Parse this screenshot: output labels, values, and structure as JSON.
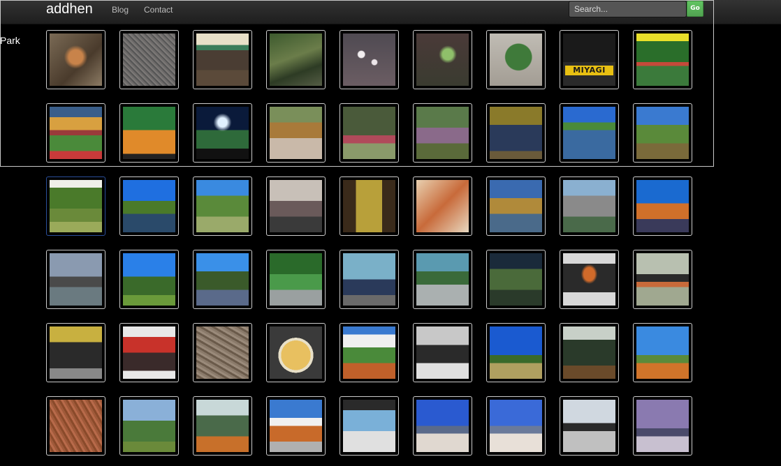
{
  "navbar": {
    "brand": "addhen",
    "links": [
      "Blog",
      "Contact"
    ],
    "search_placeholder": "Search...",
    "search_button": "Go"
  },
  "side_label": "Park",
  "overlay_text": "MIYAGI",
  "colors": {
    "navbar": "#2c2c2c",
    "go_button": "#5bb75b",
    "thumb_border": "#cccccc",
    "active_border": "#2a4f9a"
  },
  "gallery": [
    [
      {
        "name": "dry-leaves-cat-photo",
        "bg": "radial-gradient(circle at 50% 45%, #c8834a 0 18%, transparent 30%), linear-gradient(135deg,#7a6a55,#4a3b2c 60%,#8c7b64)"
      },
      {
        "name": "gravel-ground-photo",
        "bg": "repeating-linear-gradient(45deg,#6e6b6a 0 2px,#555 2px 4px,#7d7a78 4px 6px)"
      },
      {
        "name": "garden-shelter-photo",
        "bg": "linear-gradient(#e8e0c8 0 22%,#3b7d5a 22% 32%,#4a3d33 32% 70%,#5b4a3a 70%)"
      },
      {
        "name": "forest-stream-photo",
        "bg": "linear-gradient(160deg,#3d5a2e,#6b7d4a 45%,#2d3b24 70%,#555d45)"
      },
      {
        "name": "white-flowers-photo",
        "bg": "radial-gradient(circle at 35% 40%,#f2eef0 0 7%,transparent 9%), radial-gradient(circle at 60% 55%,#ede6ea 0 6%,transparent 8%), linear-gradient(#4f4a52,#6b5d63)"
      },
      {
        "name": "green-plant-photo",
        "bg": "radial-gradient(circle at 60% 40%,#8fbf6a 0 12%,transparent 20%), linear-gradient(#4a3a38,#3a3b30)"
      },
      {
        "name": "round-shrub-photo",
        "bg": "radial-gradient(circle at 55% 45%,#3f7a3a 0 32%,transparent 34%), linear-gradient(#c0bcb4,#a39d94)"
      },
      {
        "name": "miyagi-stadium-sign-photo",
        "bg": "linear-gradient(#1a1a1a 0 55%,#2a2a2a 55%)",
        "overlay": true
      },
      {
        "name": "stadium-crowd-photo",
        "bg": "linear-gradient(#e9e02a 0 15%,#2a6e2a 15% 55%,#c54a3a 55% 62%,#3b7a3b 62%)"
      }
    ],
    [
      {
        "name": "packed-stadium-photo",
        "bg": "linear-gradient(#3a5e8a 0 20%,#d8a040 20% 45%,#9a3a3a 45% 55%,#4a8a3a 55% 85%,#c83a3a 85%)"
      },
      {
        "name": "stadium-fan-photo",
        "bg": "linear-gradient(#2a7a3a 0 45%,#e08a2a 45% 90%,#222 90%)"
      },
      {
        "name": "stadium-night-lights-photo",
        "bg": "radial-gradient(circle at 50% 30%,#e0f0ff 0 10%,transparent 20%), linear-gradient(#0a1a3a 0 45%,#2e6a3a 45% 80%,#111 80%)"
      },
      {
        "name": "autumn-path-photo",
        "bg": "linear-gradient(#7a8f5a 0 30%,#a87a3a 30% 60%,#c9b9a9 60%)"
      },
      {
        "name": "autumn-garden-photo",
        "bg": "linear-gradient(#4a5a3a 0 55%,#b04a5a 55% 70%,#8a9a6a 70%)"
      },
      {
        "name": "woodland-trail-photo",
        "bg": "linear-gradient(#5a7a4a 0 40%,#8a6a8a 40% 70%,#5a6a3a 70%)"
      },
      {
        "name": "leafy-path-photo",
        "bg": "linear-gradient(#8a7a2a 0 35%,#2a3a5a 35% 85%,#6a5a3a 85%)"
      },
      {
        "name": "pond-reflection-photo",
        "bg": "linear-gradient(#2a6ad0 0 30%,#4a8a3a 30% 45%,#3a6aa0 45%)"
      },
      {
        "name": "park-hills-photo",
        "bg": "linear-gradient(#3a7ad0 0 35%,#5a8a3a 35% 70%,#7a6a3a 70%)"
      }
    ],
    [
      {
        "name": "garden-trees-photo",
        "active": true,
        "bg": "linear-gradient(#f0f0e8 0 15%,#4a7a2a 15% 55%,#6a8a3a 55% 80%,#9aaa5a 80%)"
      },
      {
        "name": "autumn-lake-photo",
        "bg": "linear-gradient(#1f6fe0 0 40%,#4a7a2a 40% 65%,#2a4a6a 65%)"
      },
      {
        "name": "valley-garden-photo",
        "bg": "linear-gradient(#3a8ae0 0 30%,#5a8a3a 30% 70%,#9aaa6a 70%)"
      },
      {
        "name": "city-street-crowd-photo",
        "bg": "linear-gradient(#c8c0b8 0 40%,#6a5a5a 40% 70%,#3a3a3a 70%)"
      },
      {
        "name": "menu-poster-photo",
        "bg": "linear-gradient(90deg,#3a2a1a 0 25%,#b8a03a 25% 75%,#3a2a1a 75%)"
      },
      {
        "name": "food-menu-photo",
        "bg": "linear-gradient(135deg,#e8d0b0,#c86a3a 50%,#e8d8c0)"
      },
      {
        "name": "autumn-park-photo",
        "bg": "linear-gradient(#3a6ab0 0 35%,#b08a3a 35% 65%,#4a6a8a 65%)"
      },
      {
        "name": "city-aerial-photo",
        "bg": "linear-gradient(#8ab0d0 0 30%,#8a8a8a 30% 70%,#4a6a4a 70%)"
      },
      {
        "name": "city-towers-photo",
        "bg": "linear-gradient(#1a6ad0 0 45%,#d0702a 45% 75%,#3a3a5a 75%)"
      }
    ],
    [
      {
        "name": "city-waterfront-photo",
        "bg": "linear-gradient(#8a9ab0 0 45%,#4a4a4a 45% 65%,#6a7a80 65%)"
      },
      {
        "name": "clear-sky-forest-photo",
        "bg": "linear-gradient(#2a80e8 0 45%,#3a6a2a 45% 80%,#6a9a3a 80%)"
      },
      {
        "name": "river-trees-photo",
        "bg": "linear-gradient(#3a90e8 0 35%,#3a5a2a 35% 70%,#5a6a8a 70%)"
      },
      {
        "name": "mossy-waterfall-photo",
        "bg": "linear-gradient(#2a6a2a 0 40%,#4a9a4a 40% 70%,#9aa0a0 70%)"
      },
      {
        "name": "station-building-photo",
        "bg": "linear-gradient(#7ab0c8 0 50%,#2a3a5a 50% 80%,#6a6a6a 80%)"
      },
      {
        "name": "canal-view-photo",
        "bg": "linear-gradient(#5a9ab0 0 35%,#3a6a3a 35% 60%,#aab0b0 60%)"
      },
      {
        "name": "bookshelf-room-photo",
        "bg": "linear-gradient(#1a2a3a 0 30%,#4a6a3a 30% 70%,#2a3a2a 70%)"
      },
      {
        "name": "laptop-desk-photo",
        "bg": "radial-gradient(ellipse at 50% 40%,#d06a2a 0 15%,transparent 22%), linear-gradient(#d8d8d8 0 20%,#2a2a2a 20% 75%,#d8d8d8 75%)"
      },
      {
        "name": "colorful-bags-photo",
        "bg": "linear-gradient(#b8c0b0 0 40%,#2a2a2a 40% 55%,#c86a3a 55% 65%,#a0a890 65%)"
      }
    ],
    [
      {
        "name": "vintage-car-photo",
        "bg": "linear-gradient(#c8b040 0 30%,#2a2a2a 30% 80%,#888 80%)"
      },
      {
        "name": "carved-stool-photo",
        "bg": "linear-gradient(#e8e8e8 0 20%,#c8322a 20% 50%,#3a2a2a 50% 85%,#e8e8e8 85%)"
      },
      {
        "name": "pebble-ground-photo",
        "bg": "repeating-linear-gradient(30deg,#8a7a6a 0 3px,#6a5a4a 3px 6px,#9a8a7a 6px 9px)"
      },
      {
        "name": "fried-rice-photo",
        "bg": "radial-gradient(circle at 50% 55%,#e8c060 0 38%,#e8e0c8 38% 45%,#3a3a3a 45%)"
      },
      {
        "name": "dirt-road-clouds-photo",
        "bg": "linear-gradient(#3a7ad0 0 15%,#f0f0f0 15% 40%,#4a8a3a 40% 70%,#c0602a 70%)"
      },
      {
        "name": "wooden-bench-photo",
        "bg": "linear-gradient(#c8c8c8 0 35%,#2a2a2a 35% 70%,#e0e0e0 70%)"
      },
      {
        "name": "savanna-sky-photo",
        "bg": "linear-gradient(#1a5ad0 0 55%,#3a6a2a 55% 70%,#b0a060 70%)"
      },
      {
        "name": "safari-truck-photo",
        "bg": "linear-gradient(#c8d0c8 0 25%,#2a3a2a 25% 75%,#6a4a2a 75%)"
      },
      {
        "name": "dry-plain-photo",
        "bg": "linear-gradient(#3a8ae0 0 55%,#5a8a3a 55% 70%,#d0742a 70%)"
      }
    ],
    [
      {
        "name": "red-soil-photo",
        "bg": "repeating-linear-gradient(60deg,#a05a3a 0 3px,#8a4a2a 3px 6px,#b86a4a 6px 9px)"
      },
      {
        "name": "scrubland-photo",
        "bg": "linear-gradient(#8ab0d8 0 40%,#4a7a3a 40% 80%,#6a8a3a 80%)"
      },
      {
        "name": "land-rover-photo",
        "bg": "linear-gradient(#c8d8d8 0 30%,#4a6a4a 30% 70%,#c8702a 70%)"
      },
      {
        "name": "coastal-hut-photo",
        "bg": "linear-gradient(#3a7ad0 0 35%,#f0f0f0 35% 50%,#c86a2a 50% 80%,#b0b0b0 80%)"
      },
      {
        "name": "beach-tree-photo",
        "bg": "linear-gradient(#2a2a2a 0 20%,#7ab0d8 20% 60%,#e0e0e0 60%)"
      },
      {
        "name": "mountain-beach-photo",
        "bg": "linear-gradient(#2a5ad0 0 50%,#5a6a8a 50% 65%,#e0d8d0 65%)"
      },
      {
        "name": "mountain-shore-photo",
        "bg": "linear-gradient(#3a6ad8 0 50%,#6a7a9a 50% 65%,#e8e0d8 65%)"
      },
      {
        "name": "cloudy-beach-photo",
        "bg": "linear-gradient(#d0d8e0 0 45%,#2a2a2a 45% 60%,#c0c0c0 60%)"
      },
      {
        "name": "purple-sky-beach-photo",
        "bg": "linear-gradient(#8a7ab0 0 55%,#4a4a6a 55% 70%,#c8c0d0 70%)"
      }
    ]
  ]
}
